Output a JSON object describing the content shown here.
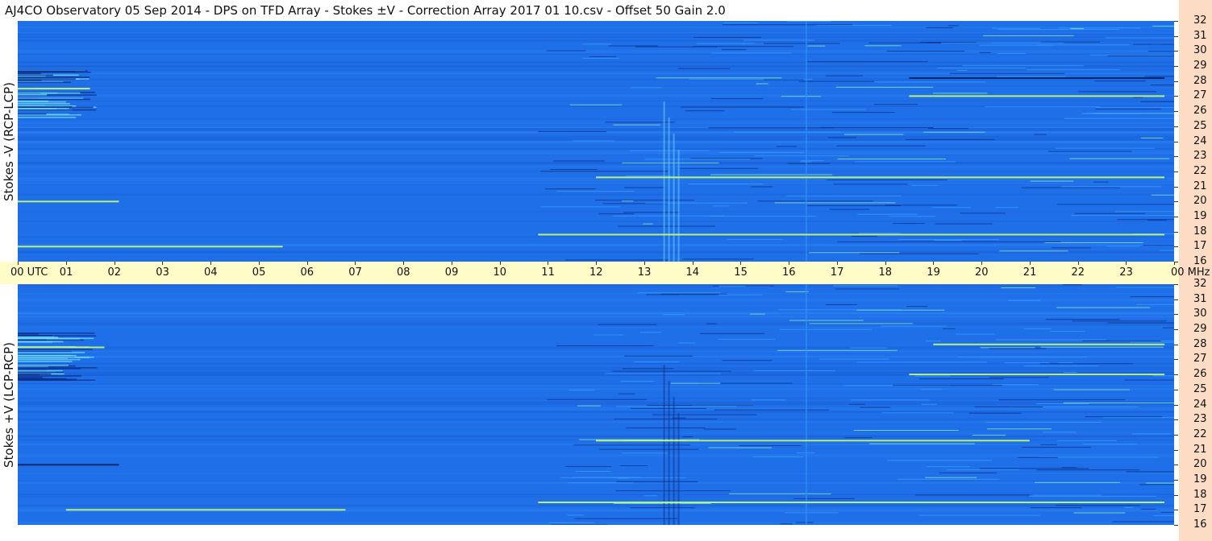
{
  "title": "AJ4CO Observatory  05 Sep 2014  -  DPS on TFD Array  -  Stokes ±V  -  Correction Array 2017 01 10.csv  -  Offset 50  Gain 2.0",
  "colors": {
    "background": "#1f6fe8",
    "time_axis_bg": "#fffcc8",
    "freq_axis_bg": "#fcdcc4"
  },
  "chart_data": [
    {
      "type": "heatmap",
      "ylabel": "Stokes -V (RCP-LCP)",
      "x_ticks": [
        "00 UTC",
        "01",
        "02",
        "03",
        "04",
        "05",
        "06",
        "07",
        "08",
        "09",
        "10",
        "11",
        "12",
        "13",
        "14",
        "15",
        "16",
        "17",
        "18",
        "19",
        "20",
        "21",
        "22",
        "23",
        "00 MHz"
      ],
      "x_range_hours": [
        0,
        24
      ],
      "y_ticks": [
        "16",
        "17",
        "18",
        "19",
        "20",
        "21",
        "22",
        "23",
        "24",
        "25",
        "26",
        "27",
        "28",
        "29",
        "30",
        "31",
        "32"
      ],
      "y_range_mhz": [
        16,
        32
      ],
      "features": [
        {
          "freq_mhz": 27.5,
          "start_h": 0.0,
          "end_h": 1.5,
          "intensity": "bright"
        },
        {
          "freq_mhz": 20.0,
          "start_h": 0.0,
          "end_h": 2.1,
          "intensity": "bright"
        },
        {
          "freq_mhz": 17.0,
          "start_h": 0.0,
          "end_h": 5.5,
          "intensity": "bright"
        },
        {
          "freq_mhz": 21.6,
          "start_h": 12.0,
          "end_h": 23.8,
          "intensity": "bright"
        },
        {
          "freq_mhz": 17.8,
          "start_h": 10.8,
          "end_h": 23.8,
          "intensity": "bright"
        },
        {
          "freq_mhz": 27.0,
          "start_h": 18.5,
          "end_h": 23.8,
          "intensity": "bright"
        },
        {
          "freq_mhz": 28.2,
          "start_h": 18.5,
          "end_h": 23.8,
          "intensity": "dark"
        }
      ]
    },
    {
      "type": "heatmap",
      "ylabel": "Stokes +V (LCP-RCP)",
      "x_ticks": [
        "00 UTC",
        "01",
        "02",
        "03",
        "04",
        "05",
        "06",
        "07",
        "08",
        "09",
        "10",
        "11",
        "12",
        "13",
        "14",
        "15",
        "16",
        "17",
        "18",
        "19",
        "20",
        "21",
        "22",
        "23",
        "00 MHz"
      ],
      "x_range_hours": [
        0,
        24
      ],
      "y_ticks": [
        "16",
        "17",
        "18",
        "19",
        "20",
        "21",
        "22",
        "23",
        "24",
        "25",
        "26",
        "27",
        "28",
        "29",
        "30",
        "31",
        "32"
      ],
      "y_range_mhz": [
        16,
        32
      ],
      "features": [
        {
          "freq_mhz": 27.8,
          "start_h": 0.0,
          "end_h": 1.8,
          "intensity": "bright"
        },
        {
          "freq_mhz": 20.0,
          "start_h": 0.0,
          "end_h": 2.1,
          "intensity": "dark"
        },
        {
          "freq_mhz": 17.0,
          "start_h": 1.0,
          "end_h": 6.8,
          "intensity": "bright"
        },
        {
          "freq_mhz": 21.6,
          "start_h": 12.0,
          "end_h": 21.0,
          "intensity": "bright"
        },
        {
          "freq_mhz": 17.5,
          "start_h": 10.8,
          "end_h": 23.8,
          "intensity": "bright"
        },
        {
          "freq_mhz": 28.0,
          "start_h": 19.0,
          "end_h": 23.8,
          "intensity": "bright"
        },
        {
          "freq_mhz": 26.0,
          "start_h": 18.5,
          "end_h": 23.8,
          "intensity": "bright"
        }
      ]
    }
  ]
}
